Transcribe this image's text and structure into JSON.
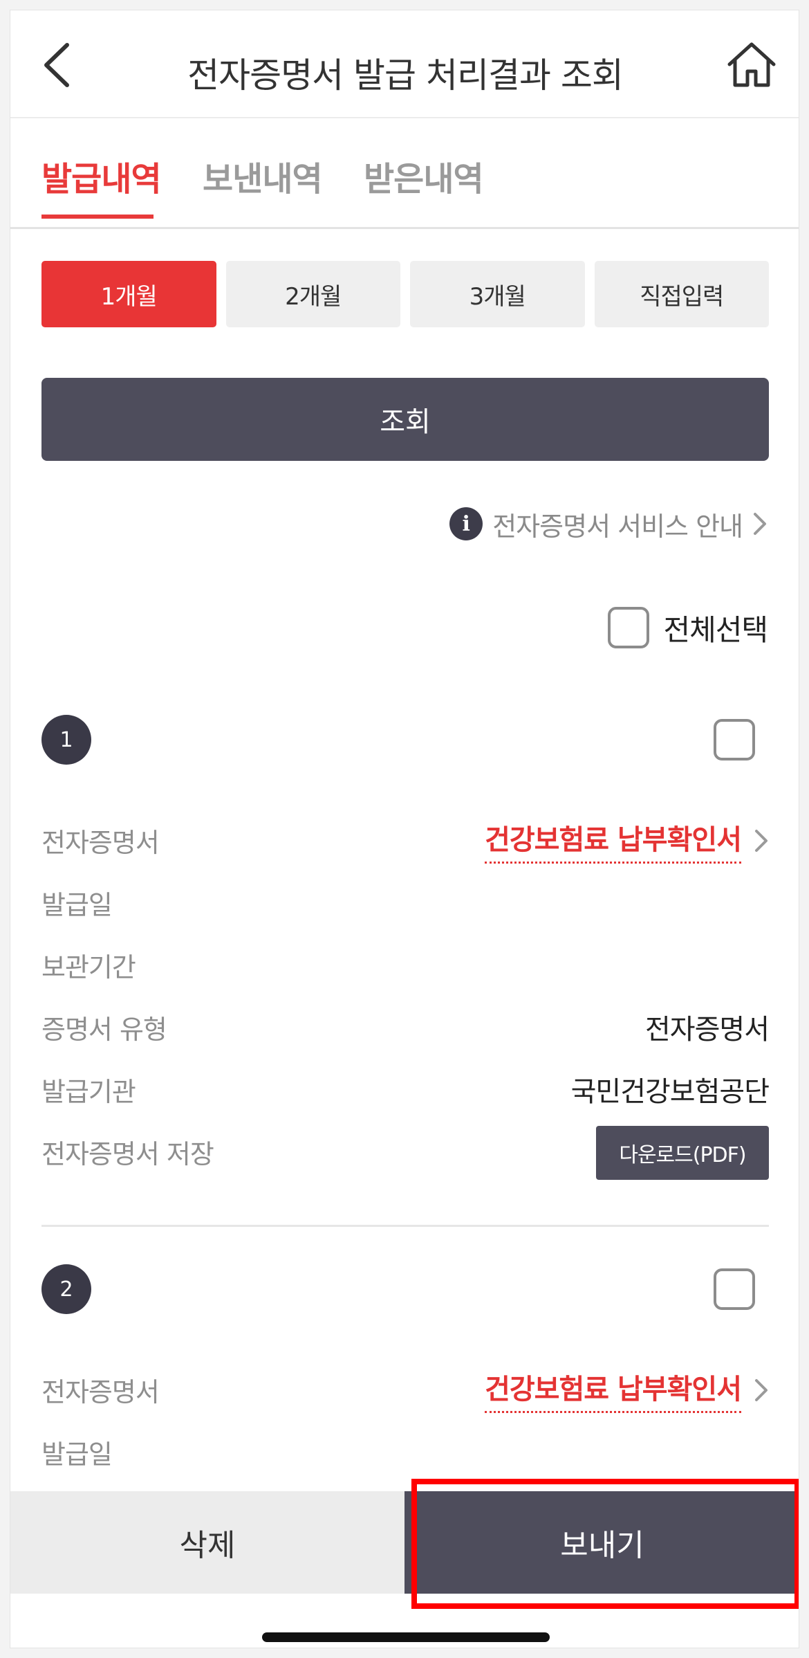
{
  "header": {
    "title": "전자증명서 발급 처리결과 조회"
  },
  "tabs": [
    {
      "label": "발급내역",
      "active": true
    },
    {
      "label": "보낸내역",
      "active": false
    },
    {
      "label": "받은내역",
      "active": false
    }
  ],
  "periods": [
    {
      "label": "1개월",
      "active": true
    },
    {
      "label": "2개월",
      "active": false
    },
    {
      "label": "3개월",
      "active": false
    },
    {
      "label": "직접입력",
      "active": false
    }
  ],
  "search_label": "조회",
  "service_info": "전자증명서 서비스 안내",
  "select_all_label": "전체선택",
  "items": [
    {
      "number": "1",
      "rows": {
        "doc_label": "전자증명서",
        "doc_value": "건강보험료 납부확인서",
        "issue_date_label": "발급일",
        "retention_label": "보관기간",
        "type_label": "증명서 유형",
        "type_value": "전자증명서",
        "agency_label": "발급기관",
        "agency_value": "국민건강보험공단",
        "save_label": "전자증명서 저장",
        "download_label": "다운로드(PDF)"
      }
    },
    {
      "number": "2",
      "rows": {
        "doc_label": "전자증명서",
        "doc_value": "건강보험료 납부확인서",
        "issue_date_label": "발급일"
      }
    }
  ],
  "bottom": {
    "delete_label": "삭제",
    "send_label": "보내기"
  },
  "colors": {
    "accent": "#e83a3a",
    "dark": "#4e4d5c",
    "highlight": "#ff0000"
  }
}
